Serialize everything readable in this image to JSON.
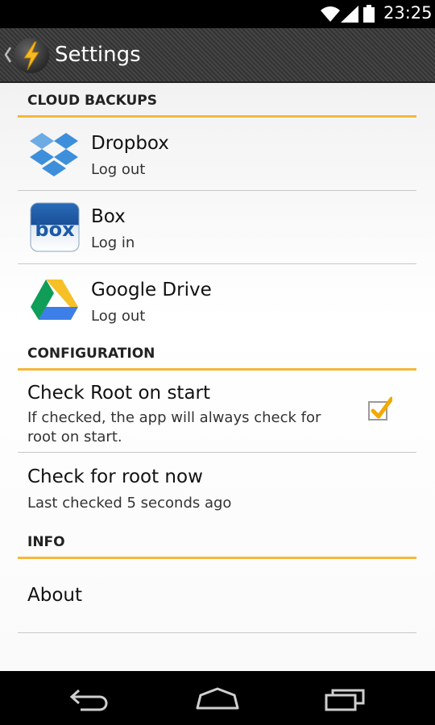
{
  "status_bar": {
    "time": "23:25"
  },
  "action_bar": {
    "title": "Settings",
    "app_icon": "lightning-bolt-icon"
  },
  "sections": {
    "cloud": {
      "header": "CLOUD BACKUPS",
      "items": [
        {
          "title": "Dropbox",
          "subtitle": "Log out",
          "icon": "dropbox-icon"
        },
        {
          "title": "Box",
          "subtitle": "Log in",
          "icon": "box-icon"
        },
        {
          "title": "Google Drive",
          "subtitle": "Log out",
          "icon": "google-drive-icon"
        }
      ]
    },
    "config": {
      "header": "CONFIGURATION",
      "items": [
        {
          "title": "Check Root on start",
          "subtitle": "If checked, the app will always check for root on start.",
          "checked": true
        },
        {
          "title": "Check for root now",
          "subtitle": "Last checked 5 seconds ago"
        }
      ]
    },
    "info": {
      "header": "INFO",
      "items": [
        {
          "title": "About"
        }
      ]
    }
  },
  "colors": {
    "accent": "#f5b73a",
    "divider": "#c8c8c8",
    "action_bar": "#3b3b3b"
  }
}
